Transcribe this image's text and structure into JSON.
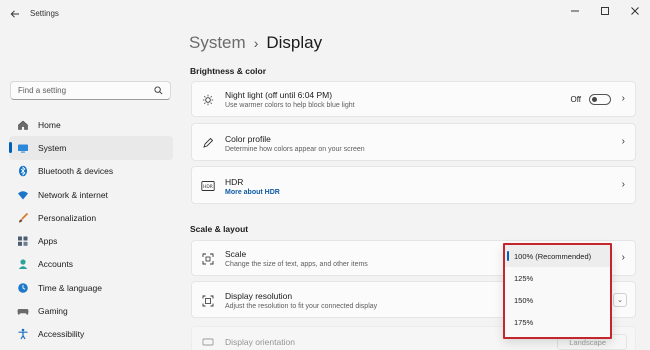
{
  "window": {
    "title": "Settings",
    "controls": [
      "minimize",
      "maximize",
      "close"
    ]
  },
  "breadcrumb": {
    "parent": "System",
    "separator": "›",
    "current": "Display"
  },
  "search": {
    "placeholder": "Find a setting"
  },
  "sidebar": {
    "items": [
      {
        "label": "Home",
        "icon": "home-icon"
      },
      {
        "label": "System",
        "icon": "monitor-icon",
        "active": true
      },
      {
        "label": "Bluetooth & devices",
        "icon": "bluetooth-icon"
      },
      {
        "label": "Network & internet",
        "icon": "wifi-icon"
      },
      {
        "label": "Personalization",
        "icon": "brush-icon"
      },
      {
        "label": "Apps",
        "icon": "apps-icon"
      },
      {
        "label": "Accounts",
        "icon": "person-icon"
      },
      {
        "label": "Time & language",
        "icon": "globe-clock-icon"
      },
      {
        "label": "Gaming",
        "icon": "gamepad-icon"
      },
      {
        "label": "Accessibility",
        "icon": "accessibility-icon"
      }
    ]
  },
  "sections": {
    "brightness": "Brightness & color",
    "scale": "Scale & layout"
  },
  "cards": {
    "night_light": {
      "title": "Night light (off until 6:04 PM)",
      "desc": "Use warmer colors to help block blue light",
      "toggle_label": "Off"
    },
    "color_profile": {
      "title": "Color profile",
      "desc": "Determine how colors appear on your screen"
    },
    "hdr": {
      "title": "HDR",
      "link": "More about HDR"
    },
    "scale": {
      "title": "Scale",
      "desc": "Change the size of text, apps, and other items"
    },
    "resolution": {
      "title": "Display resolution",
      "desc": "Adjust the resolution to fit your connected display"
    },
    "orientation": {
      "title": "Display orientation",
      "value": "Landscape"
    }
  },
  "scale_dropdown": {
    "options": [
      "100% (Recommended)",
      "125%",
      "150%",
      "175%"
    ],
    "selected": "100% (Recommended)"
  },
  "colors": {
    "accent": "#005fb8",
    "highlight_border": "#c4262e"
  }
}
